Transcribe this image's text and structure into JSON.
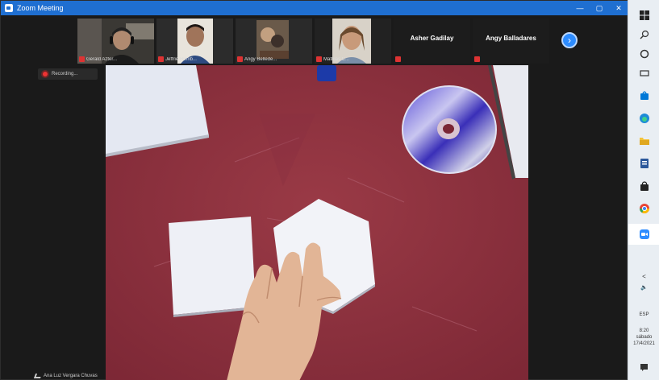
{
  "window": {
    "title": "Zoom Meeting",
    "controls": [
      "—",
      "▢",
      "✕"
    ]
  },
  "participants": [
    {
      "name": "Gerald Azter..."
    },
    {
      "name": "Jeffrie Humb..."
    },
    {
      "name": "Angy Bellede..."
    },
    {
      "name": "Mathias C..."
    },
    {
      "name": "Asher Gadilay"
    },
    {
      "name": "Angy Balladares"
    }
  ],
  "recording": {
    "label": "Recording..."
  },
  "main_video": {
    "speaker_name": "Ana Luz Vergara Chuvas"
  },
  "taskbar": {
    "tray_lang": "ESP",
    "clock_time": "8:20",
    "clock_day": "sábado",
    "clock_date": "17/4/2021",
    "chevron": "<"
  },
  "colors": {
    "zoom_blue": "#1f6fd1",
    "accent": "#2d8cff"
  }
}
